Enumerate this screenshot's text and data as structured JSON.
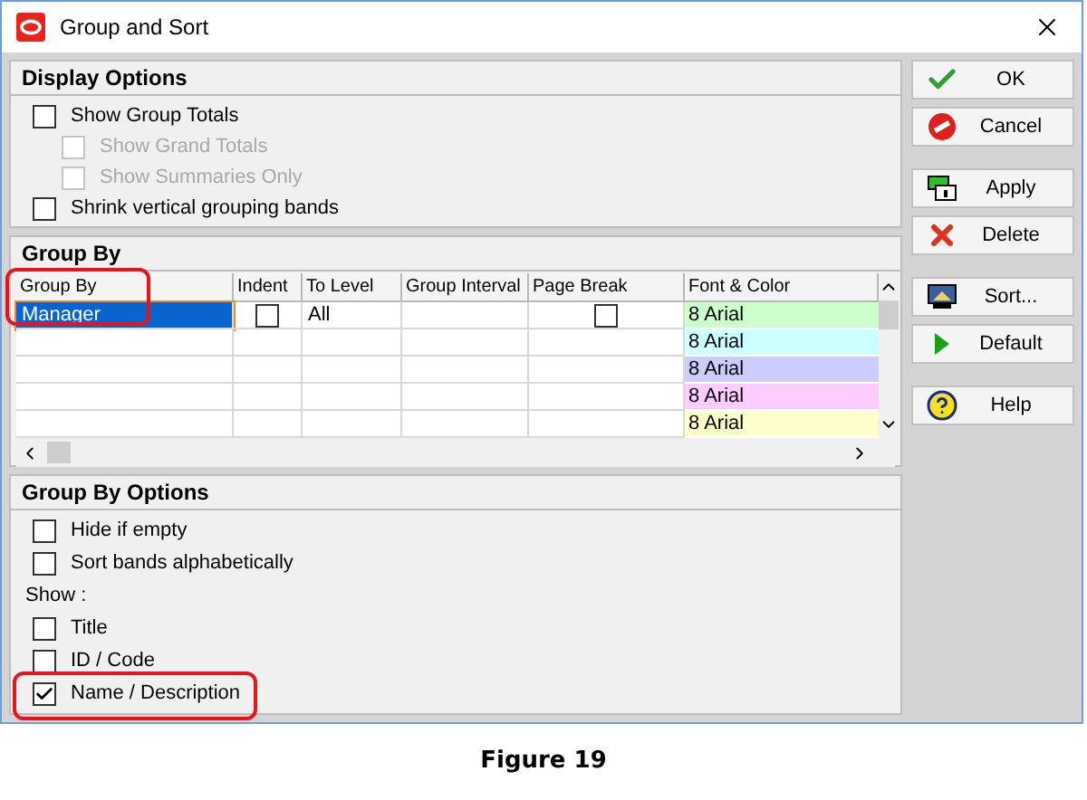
{
  "window": {
    "title": "Group and Sort"
  },
  "display_options": {
    "title": "Display Options",
    "options": [
      {
        "label": "Show Group Totals",
        "checked": false,
        "disabled": false,
        "children": [
          {
            "label": "Show Grand Totals",
            "checked": false,
            "disabled": true
          },
          {
            "label": "Show Summaries Only",
            "checked": false,
            "disabled": true
          }
        ]
      },
      {
        "label": "Shrink vertical grouping bands",
        "checked": false,
        "disabled": false
      }
    ]
  },
  "group_by": {
    "title": "Group By",
    "columns": [
      "Group By",
      "Indent",
      "To Level",
      "Group Interval",
      "Page Break",
      "Font & Color"
    ],
    "rows": [
      {
        "selected": true,
        "group_by": "Manager",
        "indent_checked": false,
        "to_level": "All",
        "page_break_checked": false,
        "font": "8 Arial",
        "color": "#ccffcc"
      },
      {
        "selected": false,
        "font": "8 Arial",
        "color": "#ccffff"
      },
      {
        "selected": false,
        "font": "8 Arial",
        "color": "#ccccff"
      },
      {
        "selected": false,
        "font": "8 Arial",
        "color": "#ffccff"
      },
      {
        "selected": false,
        "font": "8 Arial",
        "color": "#ffffcc"
      }
    ]
  },
  "group_by_options": {
    "title": "Group By Options",
    "options": [
      {
        "label": "Hide if empty",
        "checked": false
      },
      {
        "label": "Sort bands alphabetically",
        "checked": false
      }
    ],
    "show_label": "Show :",
    "show_options": [
      {
        "label": "Title",
        "checked": false,
        "highlighted": false
      },
      {
        "label": "ID / Code",
        "checked": false,
        "highlighted": false
      },
      {
        "label": "Name / Description",
        "checked": true,
        "highlighted": true
      }
    ]
  },
  "button_groups": [
    [
      {
        "label": "OK",
        "kind": "ok"
      },
      {
        "label": "Cancel",
        "kind": "cancel"
      }
    ],
    [
      {
        "label": "Apply",
        "kind": "apply"
      },
      {
        "label": "Delete",
        "kind": "delete"
      }
    ],
    [
      {
        "label": "Sort...",
        "kind": "sort"
      },
      {
        "label": "Default",
        "kind": "default"
      }
    ],
    [
      {
        "label": "Help",
        "kind": "help"
      }
    ]
  ],
  "caption": "Figure 19"
}
